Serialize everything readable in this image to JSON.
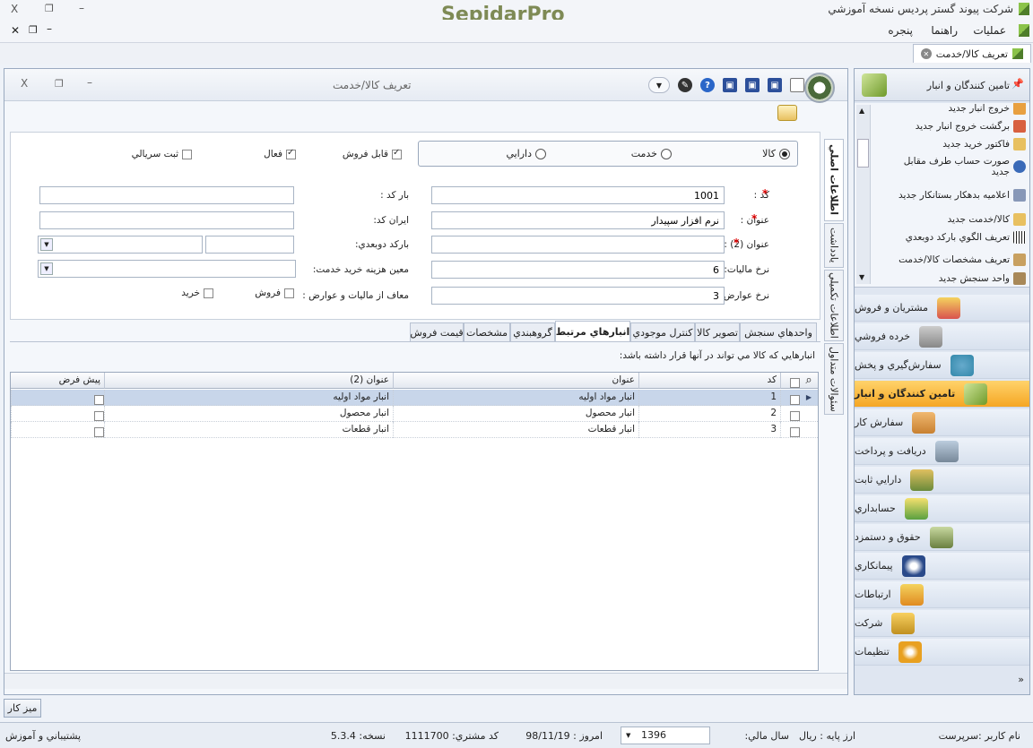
{
  "app": {
    "title": "شرکت پيوند گستر پرديس نسخه آموزشي",
    "logo": "SepidarPro",
    "window_controls": {
      "close": "X",
      "restore": "❐",
      "minimize": "–"
    }
  },
  "menu": {
    "items": [
      "عمليات",
      "راهنما",
      "پنجره"
    ]
  },
  "doc_tab": {
    "label": "تعريف کالا/خدمت"
  },
  "form": {
    "title": "تعريف کالا/خدمت",
    "type_options": [
      {
        "label": "کالا",
        "selected": true
      },
      {
        "label": "خدمت",
        "selected": false
      },
      {
        "label": "دارايي",
        "selected": false
      }
    ],
    "flags": [
      {
        "label": "قابل فروش",
        "checked": true
      },
      {
        "label": "فعال",
        "checked": true
      },
      {
        "label": "ثبت سريالي",
        "checked": false
      }
    ],
    "fields": {
      "code": {
        "label": "کد :",
        "value": "1001"
      },
      "title": {
        "label": "عنوان :",
        "value": "نرم افزار سپيدار"
      },
      "title2": {
        "label": "عنوان (2) :",
        "value": ""
      },
      "tax_rate": {
        "label": "نرخ ماليات:",
        "value": "6"
      },
      "duty_rate": {
        "label": "نرخ عوارض:",
        "value": "3"
      },
      "barcode": {
        "label": "بار کد :",
        "value": ""
      },
      "iran_code": {
        "label": "ايران کد:",
        "value": ""
      },
      "barcode2d": {
        "label": "بارکد دوبعدي:",
        "value": ""
      },
      "service_cost": {
        "label": "معين هزينه خريد خدمت:",
        "value": ""
      },
      "exempt": {
        "label": "معاف از ماليات و عوارض :",
        "options": [
          {
            "label": "فروش",
            "checked": false
          },
          {
            "label": "خريد",
            "checked": false
          }
        ]
      }
    },
    "side_tabs": [
      "اطلاعات اصلي",
      "يادداشت",
      "اطلاعات تکميلي",
      "سئوالات متداول"
    ],
    "tabs": [
      "واحدهاي سنجش",
      "تصوير کالا",
      "کنترل موجودي",
      "انبارهاي مرتبط",
      "گروهبندي",
      "مشخصات",
      "قيمت فروش"
    ],
    "active_tab": "انبارهاي مرتبط",
    "grid_caption": "انبارهايي که کالا مي تواند در آنها قرار داشته باشد:",
    "grid": {
      "columns": [
        "کد",
        "عنوان",
        "عنوان (2)",
        "پيش فرض"
      ],
      "rows": [
        {
          "code": "1",
          "title": "انبار مواد اوليه",
          "title2": "انبار مواد اوليه",
          "default": false
        },
        {
          "code": "2",
          "title": "انبار محصول",
          "title2": "انبار محصول",
          "default": false
        },
        {
          "code": "3",
          "title": "انبار قطعات",
          "title2": "انبار قطعات",
          "default": false
        }
      ]
    }
  },
  "sidebar": {
    "header": "تامين کنندگان و انبار",
    "tree_items": [
      "خروج انبار جديد",
      "برگشت خروج انبار جديد",
      "فاکتور خريد جديد",
      "صورت حساب طرف مقابل جديد",
      "اعلاميه بدهکار بستانکار جديد",
      "کالا/خدمت جديد",
      "تعريف الگوي بارکد دوبعدي",
      "تعريف مشخصات کالا/خدمت",
      "واحد سنجش جديد"
    ],
    "modules": [
      "مشتريان و فروش",
      "خرده فروشي",
      "سفارش‌گيري و پخش",
      "تامين کنندگان و انبار",
      "سفارش کار",
      "دريافت و پرداخت",
      "دارايي ثابت",
      "حسابداري",
      "حقوق و دستمزد",
      "پيمانکاري",
      "ارتباطات",
      "شرکت",
      "تنظيمات"
    ],
    "active_module": "تامين کنندگان و انبار",
    "colors": {
      "active": "#f5a623"
    }
  },
  "taskbar": {
    "desk": "ميز کار"
  },
  "status": {
    "user": "نام کاربر :سرپرست",
    "currency": "ارز پايه :  ريال",
    "fiscal_year_label": "سال مالي:",
    "fiscal_year": "1396",
    "today": "امروز :  98/11/19",
    "customer_code": "کد مشتري:  1111700",
    "version": "نسخه:  5.3.4",
    "support": "پشتيباني و آموزش"
  }
}
